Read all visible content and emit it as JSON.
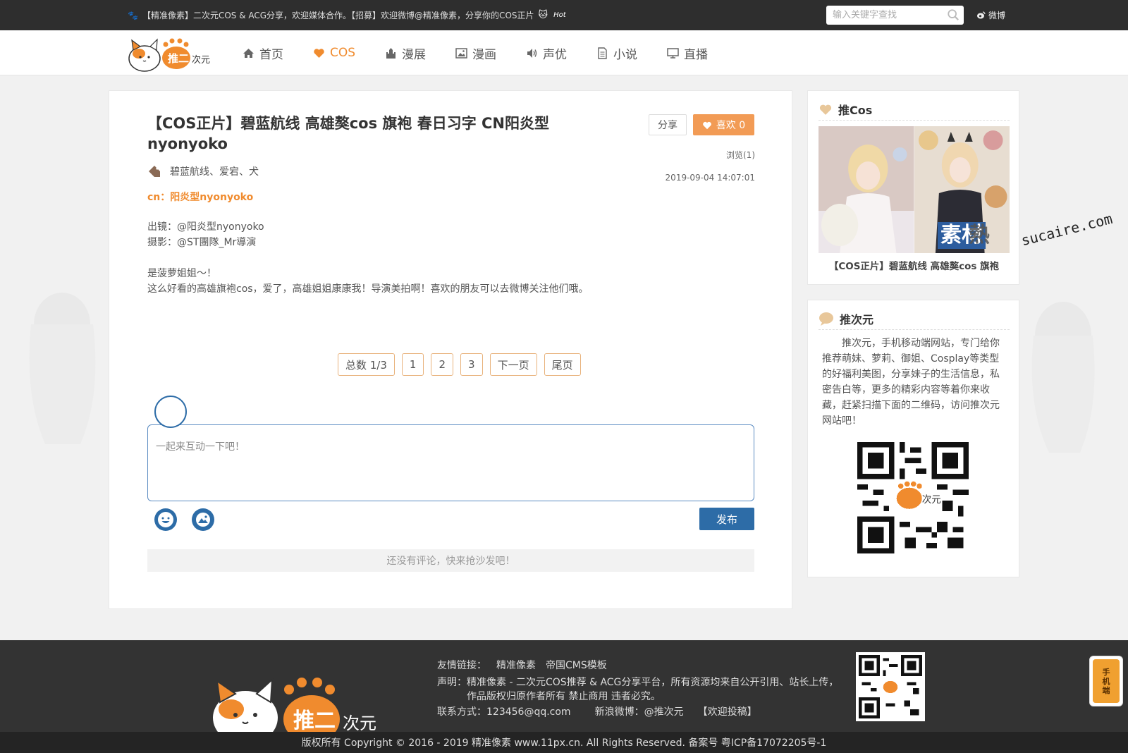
{
  "topbar": {
    "notice": "【精准像素】二次元COS & ACG分享，欢迎媒体合作。【招募】欢迎微博@精准像素，分享你的COS正片",
    "hot": "Hot",
    "search_placeholder": "输入关键字查找",
    "weibo_label": "微博"
  },
  "nav": {
    "logo_text": "推二次元",
    "items": [
      {
        "label": "首页",
        "icon": "home-icon"
      },
      {
        "label": "COS",
        "icon": "heart-icon"
      },
      {
        "label": "漫展",
        "icon": "castle-icon"
      },
      {
        "label": "漫画",
        "icon": "image-icon"
      },
      {
        "label": "声优",
        "icon": "volume-icon"
      },
      {
        "label": "小说",
        "icon": "document-icon"
      },
      {
        "label": "直播",
        "icon": "monitor-icon"
      }
    ],
    "active_index": 1
  },
  "article": {
    "title": "【COS正片】碧蓝航线 高雄獒cos 旗袍 春日习字 CN阳炎型nyonyoko",
    "share_label": "分享",
    "like_label": "喜欢 0",
    "views": "浏览(1)",
    "date": "2019-09-04 14:07:01",
    "tags": "碧蓝航线、爱宕、犬",
    "cn": "cn：阳炎型nyonyoko",
    "credit_1": "出镜：@阳炎型nyonyoko",
    "credit_2": "摄影：@ST團隊_Mr導演",
    "desc_1": "是菠萝姐姐～！",
    "desc_2": "这么好看的高雄旗袍cos，爱了，高雄姐姐康康我！导演美拍啊！喜欢的朋友可以去微博关注他们哦。"
  },
  "pager": {
    "total": "总数 1/3",
    "p1": "1",
    "p2": "2",
    "p3": "3",
    "next": "下一页",
    "last": "尾页"
  },
  "comment": {
    "placeholder": "一起来互动一下吧！",
    "publish_label": "发布",
    "empty_text": "还没有评论，快来抢沙发吧！"
  },
  "sidebar": {
    "cos_title": "推Cos",
    "cos_caption": "【COS正片】碧蓝航线 高雄獒cos 旗袍",
    "about_title": "推次元",
    "about_text": "推次元，手机移动端网站，专门给你推荐萌妹、萝莉、御姐、Cosplay等类型的好福利美图，分享妹子的生活信息，私密告白等，更多的精彩内容等着你来收藏，赶紧扫描下面的二维码，访问推次元网站吧！"
  },
  "watermark": {
    "cn": "素材",
    "cn2": "熱",
    "en": "sucaire.com"
  },
  "footer": {
    "links_label": "友情链接：",
    "link_1": "精准像素",
    "link_2": "帝国CMS模板",
    "decl_1": "声明：精准像素 - 二次元COS推荐 & ACG分享平台，所有资源均来自公开引用、站长上传，",
    "decl_2": "作品版权归原作者所有 禁止商用 违者必究。",
    "contact": "联系方式：123456@qq.com",
    "weibo": "新浪微博：@推次元",
    "submit": "【欢迎投稿】",
    "copyright": "版权所有 Copyright © 2016 - 2019 精准像素 www.11px.cn. All Rights Reserved. 备案号 粤ICP备17072205号-1",
    "mobile_1": "手",
    "mobile_2": "机",
    "mobile_3": "端"
  },
  "colors": {
    "accent": "#f08b2e",
    "like_bg": "#f29b55",
    "primary_blue": "#2d6ca7",
    "topbar_bg": "#2e2e2e",
    "footer_bg": "#333333"
  }
}
